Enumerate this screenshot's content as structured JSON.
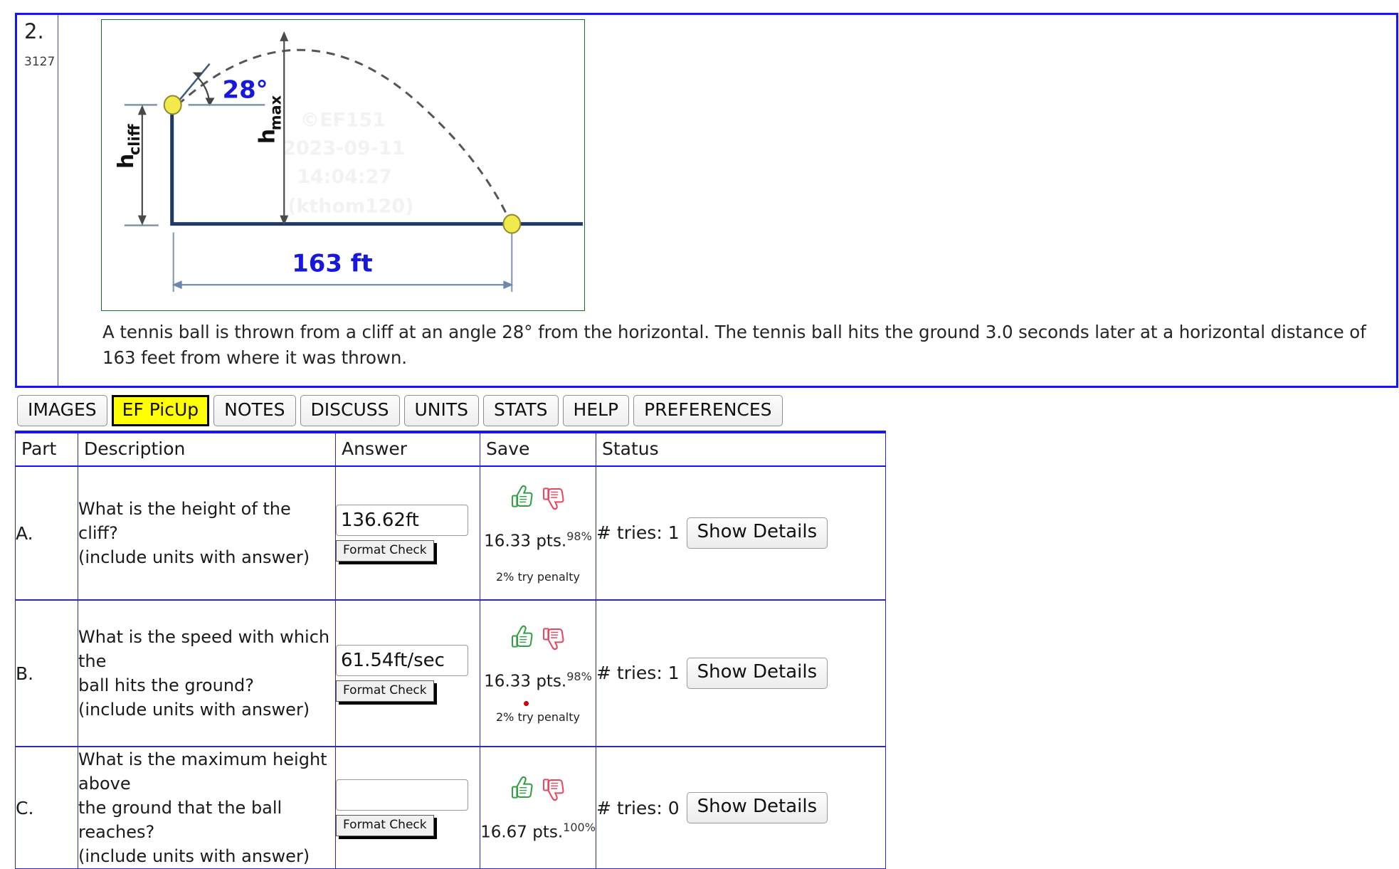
{
  "problem": {
    "number": "2.",
    "id": "3127",
    "statement": "A tennis ball is thrown from a cliff at an angle 28° from the horizontal. The tennis ball hits the ground 3.0 seconds later at a horizontal distance of 163 feet from where it was thrown."
  },
  "figure": {
    "angle_label": "28°",
    "h_cliff_label_main": "h",
    "h_cliff_label_sub": "cliff",
    "h_max_label_main": "h",
    "h_max_label_sub": "max",
    "distance_label": "163 ft",
    "watermark": [
      "©EF151",
      "2023-09-11",
      "14:04:27",
      "(kthom120)"
    ],
    "colors": {
      "label_blue": "#1818dd",
      "ground_navy": "#1f3864",
      "trajectory_gray": "#555555",
      "ball_yellow": "#f2ea4c",
      "border_green": "#1d6b2a"
    }
  },
  "tabs": [
    {
      "label": "IMAGES",
      "active": false
    },
    {
      "label": "EF PicUp",
      "active": true
    },
    {
      "label": "NOTES",
      "active": false
    },
    {
      "label": "DISCUSS",
      "active": false
    },
    {
      "label": "UNITS",
      "active": false
    },
    {
      "label": "STATS",
      "active": false
    },
    {
      "label": "HELP",
      "active": false
    },
    {
      "label": "PREFERENCES",
      "active": false
    }
  ],
  "table": {
    "headers": {
      "part": "Part",
      "description": "Description",
      "answer": "Answer",
      "save": "Save",
      "status": "Status"
    },
    "format_check_label": "Format Check",
    "show_details_label": "Show Details",
    "rows": [
      {
        "part": "A.",
        "description_lines": [
          "What is the height of the cliff?",
          "(include units with answer)"
        ],
        "answer_value": "136.62ft",
        "answer_placeholder": "",
        "points": "16.33 pts.",
        "percent": "98%",
        "penalty": "2% try penalty",
        "penalty_dot": false,
        "tries": "# tries: 1"
      },
      {
        "part": "B.",
        "description_lines": [
          "What is the speed with which the",
          "ball hits the ground?",
          "(include units with answer)"
        ],
        "answer_value": "61.54ft/sec",
        "answer_placeholder": "",
        "points": "16.33 pts.",
        "percent": "98%",
        "penalty": "2% try penalty",
        "penalty_dot": true,
        "tries": "# tries: 1"
      },
      {
        "part": "C.",
        "description_lines": [
          "What is the maximum height above",
          "the ground that the ball reaches?",
          "(include units with answer)"
        ],
        "answer_value": "",
        "answer_placeholder": "",
        "points": "16.67 pts.",
        "percent": "100%",
        "penalty": "",
        "penalty_dot": false,
        "tries": "# tries: 0"
      }
    ]
  },
  "icons": {
    "thumbs_up": "thumbs-up-icon",
    "thumbs_down": "thumbs-down-icon"
  },
  "colors": {
    "frame_blue": "#1414ff",
    "table_border_blue": "#2b2bb5",
    "active_tab_yellow": "#ffff00",
    "thumb_up_green": "#2f9e44",
    "thumb_down_red": "#e8455e"
  }
}
